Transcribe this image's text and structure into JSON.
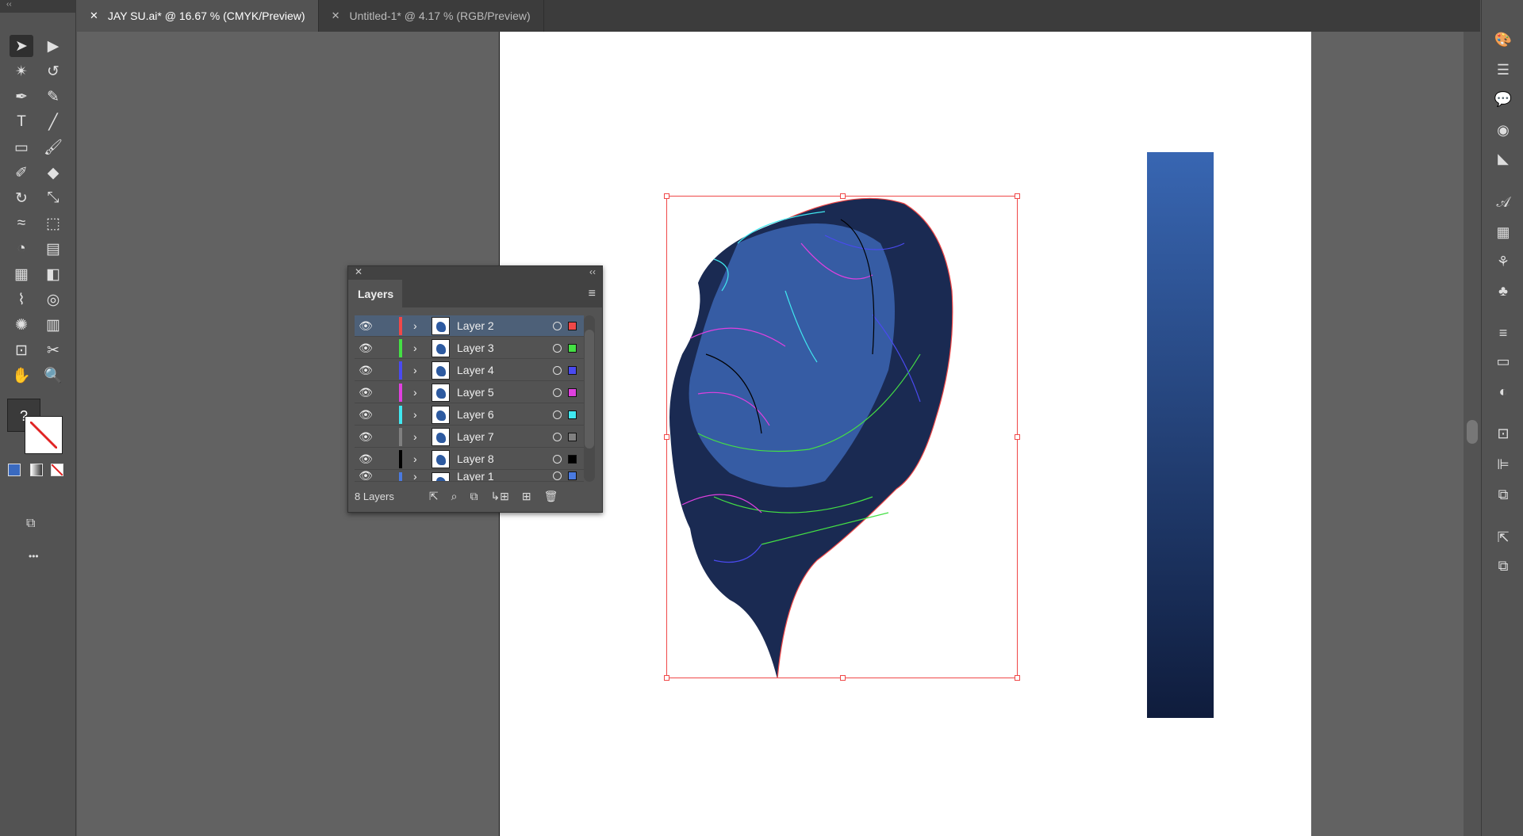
{
  "tabs": [
    {
      "label": "JAY SU.ai* @ 16.67 % (CMYK/Preview)",
      "active": true
    },
    {
      "label": "Untitled-1* @ 4.17 % (RGB/Preview)",
      "active": false
    }
  ],
  "toolbar": {
    "collapse": "‹‹",
    "tools": [
      "selection-tool",
      "direct-selection-tool",
      "magic-wand-tool",
      "lasso-tool",
      "pen-tool",
      "curvature-tool",
      "type-tool",
      "line-tool",
      "rectangle-tool",
      "paintbrush-tool",
      "shaper-tool",
      "eraser-tool",
      "rotate-tool",
      "scale-tool",
      "width-tool",
      "free-transform-tool",
      "shape-builder-tool",
      "perspective-grid-tool",
      "mesh-tool",
      "gradient-tool",
      "eyedropper-tool",
      "blend-tool",
      "symbol-sprayer-tool",
      "column-graph-tool",
      "artboard-tool",
      "slice-tool",
      "hand-tool",
      "zoom-tool"
    ],
    "fill_unknown": "?",
    "more": "•••"
  },
  "layers_panel": {
    "title": "Layers",
    "footer": "8 Layers",
    "layers": [
      {
        "name": "Layer 2",
        "color": "#f04848",
        "selected": true
      },
      {
        "name": "Layer 3",
        "color": "#44e044"
      },
      {
        "name": "Layer 4",
        "color": "#4a4af0"
      },
      {
        "name": "Layer 5",
        "color": "#e040e0"
      },
      {
        "name": "Layer 6",
        "color": "#40e8f0"
      },
      {
        "name": "Layer 7",
        "color": "#808080"
      },
      {
        "name": "Layer 8",
        "color": "#000000"
      },
      {
        "name": "Layer 1",
        "color": "#4a7ae0"
      }
    ]
  },
  "colors": {
    "gradient_top": "#3866b2",
    "gradient_bottom": "#0f1c3c",
    "face_fill": "#1a2a52"
  }
}
